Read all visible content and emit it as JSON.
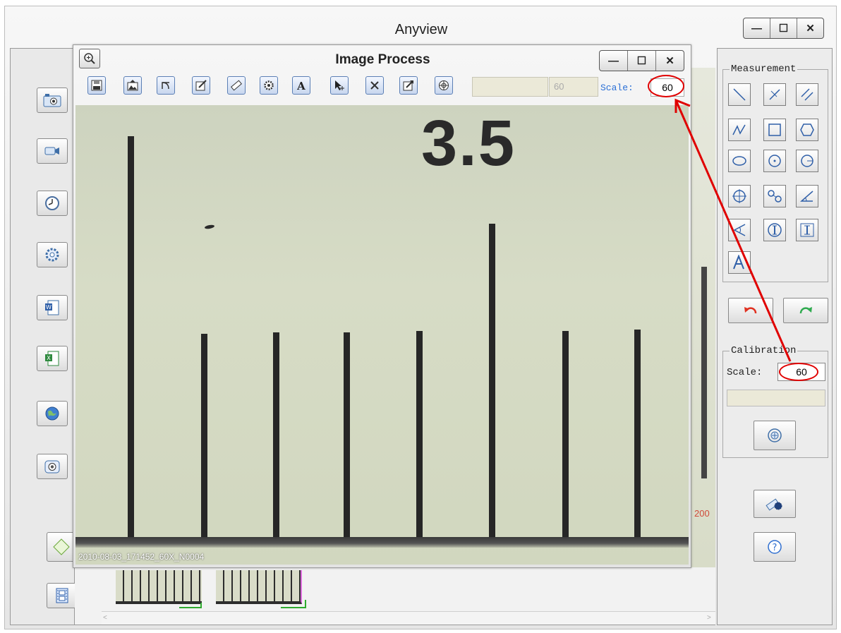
{
  "main_window": {
    "title": "Anyview",
    "controls": [
      "—",
      "☐",
      "✕"
    ]
  },
  "image_process": {
    "title": "Image Process",
    "controls": [
      "—",
      "☐",
      "✕"
    ],
    "input_value": "60",
    "scale_label": "Scale:",
    "scale_value": "60",
    "filename": "2010-08-03_171452_60X_N0004",
    "ruler_number": "3.5"
  },
  "right_panel": {
    "measurement_label": "Measurement",
    "calibration_label": "Calibration",
    "calibration_scale_label": "Scale:",
    "calibration_scale_value": "60",
    "behind_label": "200"
  },
  "colors": {
    "annotation": "#e00000",
    "scale_text": "#2a6fd6"
  }
}
